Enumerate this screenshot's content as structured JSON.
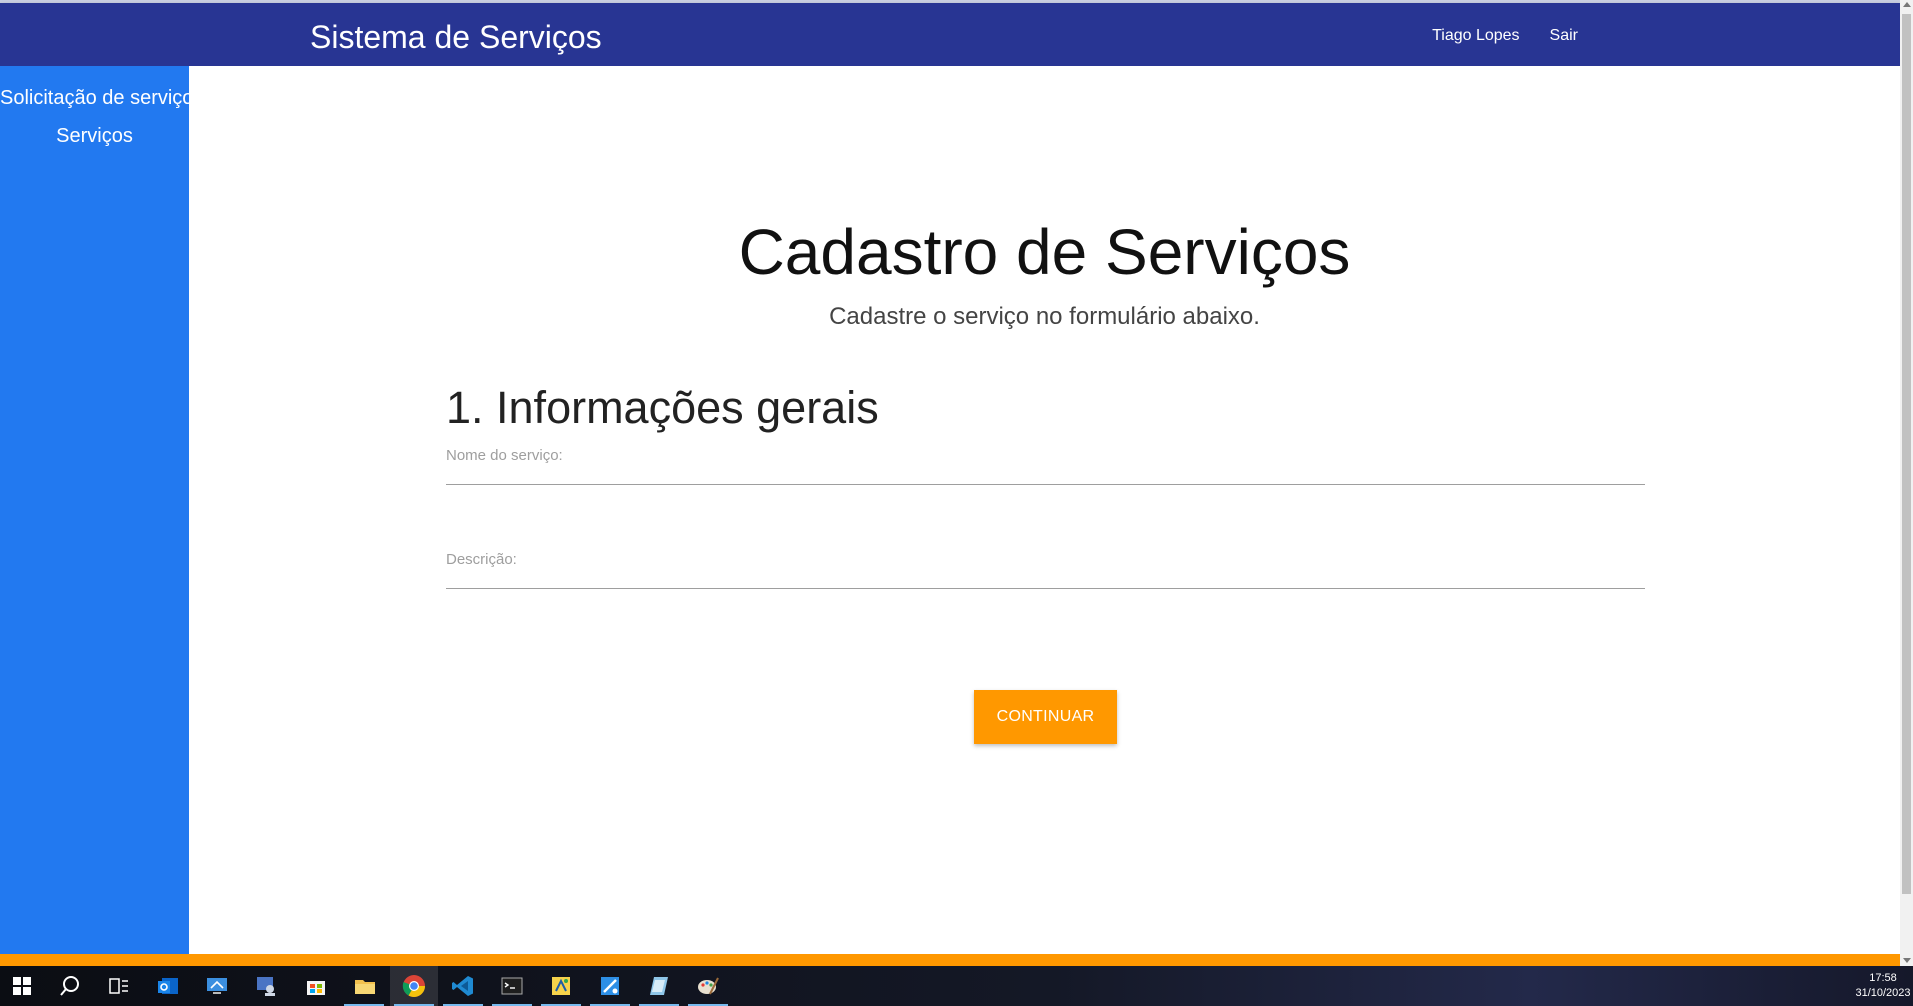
{
  "header": {
    "brand": "Sistema de Serviços",
    "user_name": "Tiago Lopes",
    "logout_label": "Sair"
  },
  "sidebar": {
    "items": [
      {
        "label": "Solicitação de serviço"
      },
      {
        "label": "Serviços"
      }
    ]
  },
  "main": {
    "title": "Cadastro de Serviços",
    "subtitle": "Cadastre o serviço no formulário abaixo.",
    "section_title": "1. Informações gerais",
    "fields": {
      "service_name_label": "Nome do serviço:",
      "service_name_value": "",
      "description_label": "Descrição:",
      "description_value": ""
    },
    "continue_label": "CONTINUAR"
  },
  "taskbar": {
    "icons": [
      "windows-start-icon",
      "search-icon",
      "task-view-icon",
      "outlook-icon",
      "remote-desktop-icon",
      "user-management-icon",
      "store-icon",
      "file-explorer-icon",
      "chrome-icon",
      "vscode-icon",
      "terminal-icon",
      "python-app-icon",
      "paint-app-icon",
      "notes-app-icon",
      "palette-app-icon"
    ],
    "clock_time": "17:58",
    "clock_date": "31/10/2023"
  },
  "colors": {
    "navbar": "#283593",
    "sidebar": "#2279f0",
    "accent": "#ff9800"
  }
}
